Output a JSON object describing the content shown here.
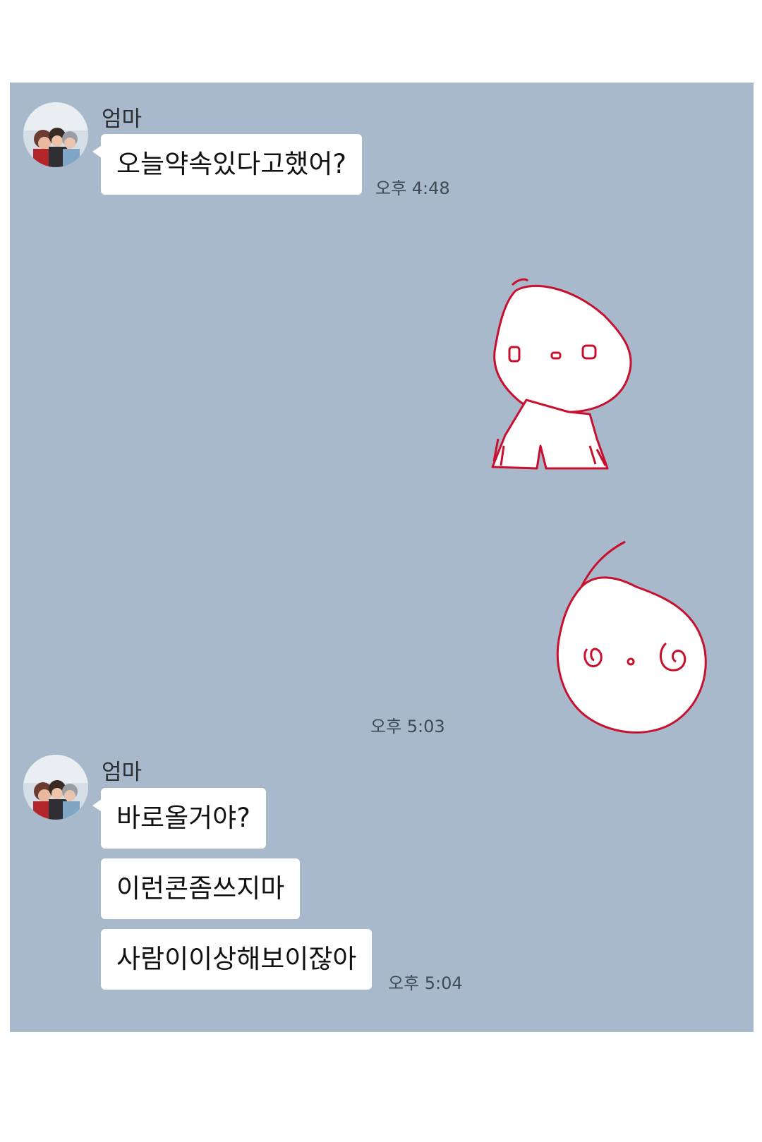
{
  "messages": [
    {
      "sender": "엄마",
      "bubbles": [
        "오늘약속있다고했어?"
      ],
      "time": "오후 4:48"
    },
    {
      "emoticon_time": "오후 5:03"
    },
    {
      "sender": "엄마",
      "bubbles": [
        "바로올거야?",
        "이런콘좀쓰지마",
        "사람이이상해보이잖아"
      ],
      "time": "오후 5:04"
    }
  ],
  "colors": {
    "chat_background": "#a8b9cb",
    "bubble": "#ffffff",
    "emoticon_outline": "#c8102e"
  },
  "icons": [
    "profile-avatar",
    "doodle-character-emoticon",
    "doodle-face-emoticon"
  ]
}
